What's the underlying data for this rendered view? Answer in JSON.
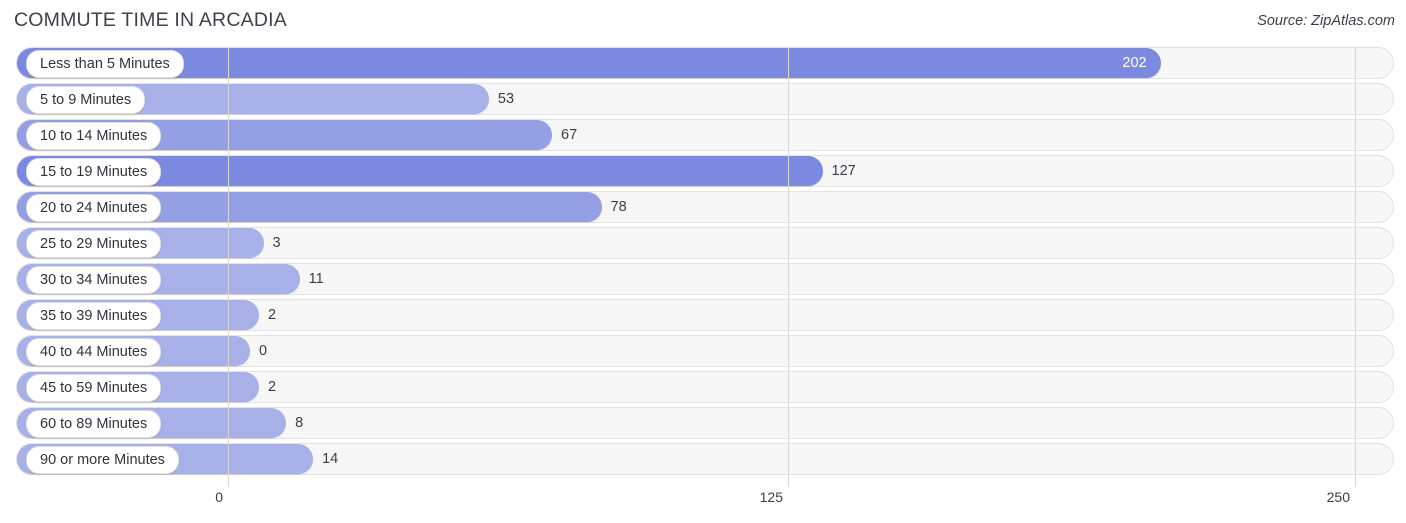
{
  "header": {
    "title": "COMMUTE TIME IN ARCADIA",
    "source": "Source: ZipAtlas.com"
  },
  "axis": {
    "ticks": [
      "0",
      "125",
      "250"
    ]
  },
  "chart_data": {
    "type": "bar",
    "orientation": "horizontal",
    "title": "COMMUTE TIME IN ARCADIA",
    "xlabel": "",
    "ylabel": "",
    "xlim": [
      0,
      250
    ],
    "grid": true,
    "legend": false,
    "source": "Source: ZipAtlas.com",
    "categories": [
      "Less than 5 Minutes",
      "5 to 9 Minutes",
      "10 to 14 Minutes",
      "15 to 19 Minutes",
      "20 to 24 Minutes",
      "25 to 29 Minutes",
      "30 to 34 Minutes",
      "35 to 39 Minutes",
      "40 to 44 Minutes",
      "45 to 59 Minutes",
      "60 to 89 Minutes",
      "90 or more Minutes"
    ],
    "values": [
      202,
      53,
      67,
      127,
      78,
      3,
      11,
      2,
      0,
      2,
      8,
      14
    ],
    "value_labels": [
      "202",
      "53",
      "67",
      "127",
      "78",
      "3",
      "11",
      "2",
      "0",
      "2",
      "8",
      "14"
    ],
    "tick_values": [
      0,
      125,
      250
    ],
    "bar_color": "#a8b0e8",
    "bar_color_high": "#7b8adf",
    "track_color": "#f7f7f8"
  }
}
